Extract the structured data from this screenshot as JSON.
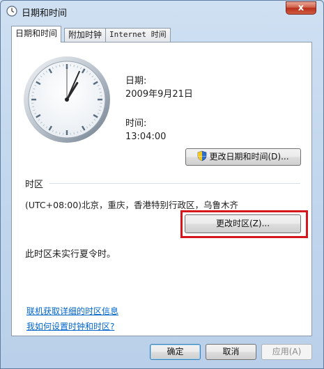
{
  "window": {
    "title": "日期和时间",
    "close_label": "x"
  },
  "tabs": [
    {
      "label": "日期和时间",
      "active": true
    },
    {
      "label": "附加时钟",
      "active": false
    },
    {
      "label": "Internet 时间",
      "active": false
    }
  ],
  "clock": {
    "time": "13:04:00"
  },
  "date_section": {
    "date_label": "日期:",
    "date_value": "2009年9月21日"
  },
  "time_section": {
    "time_label": "时间:",
    "time_value": "13:04:00"
  },
  "change_datetime_button": "更改日期和时间(D)...",
  "timezone": {
    "heading": "时区",
    "value": "(UTC+08:00)北京，重庆，香港特别行政区，乌鲁木齐",
    "change_button": "更改时区(Z)...",
    "dst_note": "此时区未实行夏令时。"
  },
  "links": {
    "online_info": "联机获取详细的时区信息",
    "how_to": "我如何设置时钟和时区?"
  },
  "footer": {
    "ok": "确定",
    "cancel": "取消",
    "apply": "应用(A)"
  },
  "colors": {
    "highlight": "#d6161d",
    "link": "#0066cc",
    "close": "#c8442c"
  }
}
